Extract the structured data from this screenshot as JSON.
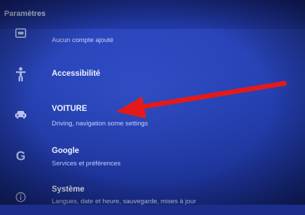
{
  "header": {
    "title": "Paramètres"
  },
  "items": [
    {
      "label": "",
      "sub": "Aucun compte ajouté",
      "icon": "accounts-icon"
    },
    {
      "label": "Accessibilité",
      "sub": "",
      "icon": "accessibility-icon"
    },
    {
      "label": "VOITURE",
      "sub": "Driving, navigation some settings",
      "icon": "car-icon"
    },
    {
      "label": "Google",
      "sub": "Services et préférences",
      "icon": "google-icon"
    },
    {
      "label": "Système",
      "sub": "Langues, date et heure, sauvegarde, mises à jour",
      "icon": "info-icon"
    }
  ],
  "colors": {
    "background": "#2541b3",
    "arrow": "#e41a1a"
  }
}
